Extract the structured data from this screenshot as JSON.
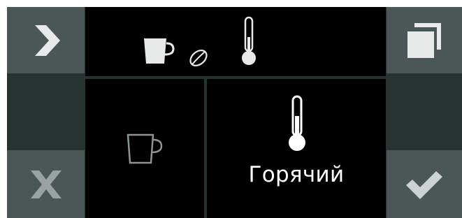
{
  "left_panel": {
    "next_icon": "chevron-right-icon",
    "cancel_icon": "close-icon"
  },
  "right_panel": {
    "copy_icon": "copy-icon",
    "confirm_icon": "checkmark-icon"
  },
  "header": {
    "icons": [
      "cup-full-icon",
      "coffee-bean-icon",
      "thermometer-icon"
    ]
  },
  "settings": {
    "cup_icon": "cup-outline-icon",
    "temperature_icon": "thermometer-icon",
    "temperature_label": "Горячий"
  },
  "colors": {
    "background": "#263331",
    "side_button": "#4b5756",
    "pane": "#000000",
    "icon_light": "#e8eaea",
    "cup_outline": "#8c9494",
    "check": "#cdd3d2",
    "close": "#9aa3a2"
  }
}
